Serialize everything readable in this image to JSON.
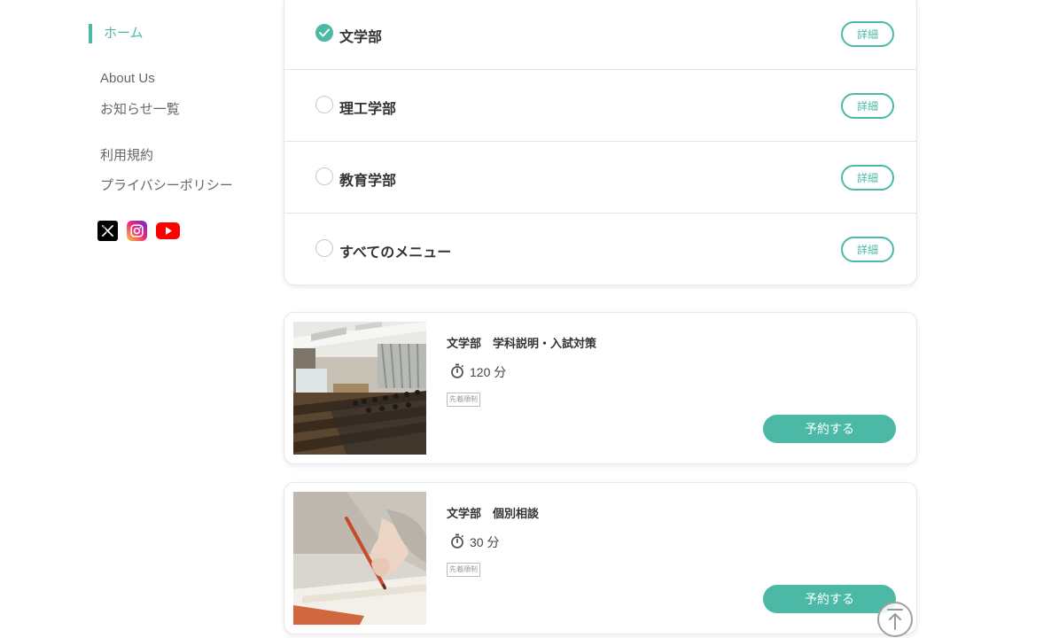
{
  "sidebar": {
    "home_label": "ホーム",
    "links": [
      {
        "label": "About Us"
      },
      {
        "label": "お知らせ一覧"
      },
      {
        "label": "利用規約"
      },
      {
        "label": "プライバシーポリシー"
      }
    ],
    "social": [
      {
        "icon": "x-icon"
      },
      {
        "icon": "instagram-icon"
      },
      {
        "icon": "youtube-icon"
      }
    ]
  },
  "menu": {
    "items": [
      {
        "label": "文学部",
        "checked": true,
        "detail_label": "詳細"
      },
      {
        "label": "理工学部",
        "checked": false,
        "detail_label": "詳細"
      },
      {
        "label": "教育学部",
        "checked": false,
        "detail_label": "詳細"
      },
      {
        "label": "すべてのメニュー",
        "checked": false,
        "detail_label": "詳細"
      }
    ]
  },
  "courses": [
    {
      "title": "文学部　学科説明・入試対策",
      "duration": "120 分",
      "tag": "先着順制",
      "reserve_label": "予約する",
      "image": "lecture-hall"
    },
    {
      "title": "文学部　個別相談",
      "duration": "30 分",
      "tag": "先着順制",
      "reserve_label": "予約する",
      "image": "writing-hand"
    }
  ],
  "colors": {
    "accent": "#4cb9a7",
    "text": "#333333",
    "muted": "#666666"
  }
}
